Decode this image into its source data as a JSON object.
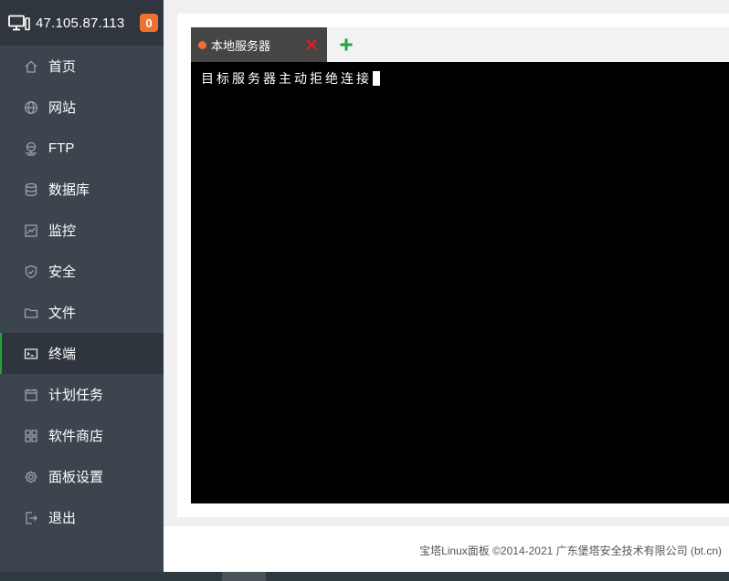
{
  "header": {
    "ip": "47.105.87.113",
    "badge": "0"
  },
  "menu": [
    {
      "label": "首页",
      "icon": "home-icon"
    },
    {
      "label": "网站",
      "icon": "globe-icon"
    },
    {
      "label": "FTP",
      "icon": "ftp-icon"
    },
    {
      "label": "数据库",
      "icon": "database-icon"
    },
    {
      "label": "监控",
      "icon": "monitor-chart-icon"
    },
    {
      "label": "安全",
      "icon": "shield-icon"
    },
    {
      "label": "文件",
      "icon": "folder-icon"
    },
    {
      "label": "终端",
      "icon": "terminal-icon",
      "active": true
    },
    {
      "label": "计划任务",
      "icon": "calendar-icon"
    },
    {
      "label": "软件商店",
      "icon": "grid-icon"
    },
    {
      "label": "面板设置",
      "icon": "gear-icon"
    },
    {
      "label": "退出",
      "icon": "logout-icon"
    }
  ],
  "terminal": {
    "tab_label": "本地服务器",
    "output": "目标服务器主动拒绝连接"
  },
  "footer": {
    "text": "宝塔Linux面板 ©2014-2021 广东堡塔安全技术有限公司 (bt.cn)"
  },
  "colors": {
    "accent": "#20a53a",
    "badge": "#f0712e",
    "tab_dot": "#f26c3a",
    "close": "#e02020"
  }
}
